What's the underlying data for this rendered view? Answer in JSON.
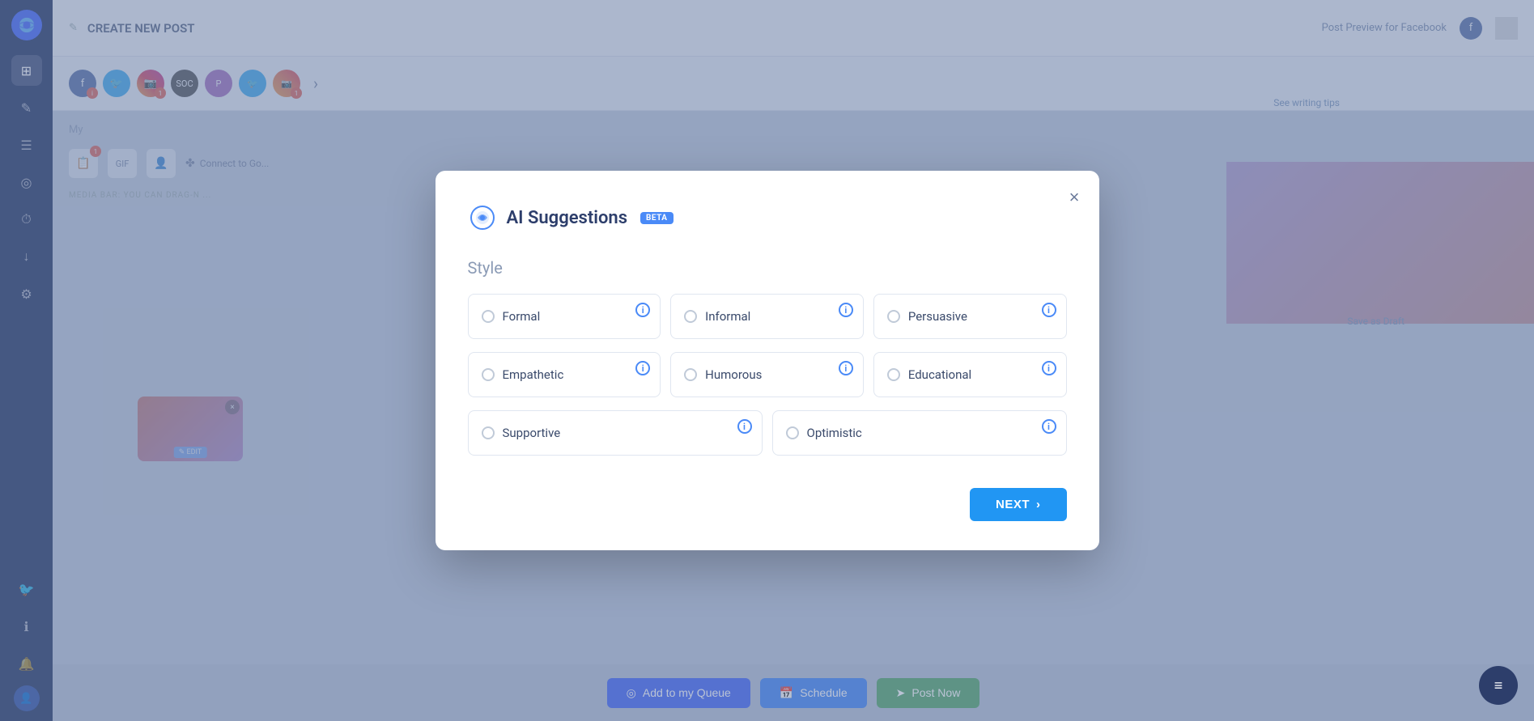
{
  "app": {
    "title": "CREATE NEW POST",
    "beta_label": "BETA"
  },
  "sidebar": {
    "logo_icon": "🌐",
    "items": [
      {
        "label": "dashboard",
        "icon": "⊞",
        "active": false
      },
      {
        "label": "compose",
        "icon": "✎",
        "active": true
      },
      {
        "label": "posts",
        "icon": "☰",
        "active": false
      },
      {
        "label": "feed",
        "icon": "◉",
        "active": false
      },
      {
        "label": "analytics",
        "icon": "⏱",
        "active": false
      },
      {
        "label": "download",
        "icon": "↓",
        "active": false
      },
      {
        "label": "settings",
        "icon": "⚙",
        "active": false
      }
    ],
    "bottom_items": [
      {
        "label": "twitter",
        "icon": "🐦"
      },
      {
        "label": "info",
        "icon": "ℹ"
      },
      {
        "label": "notifications",
        "icon": "🔔"
      },
      {
        "label": "profile",
        "icon": "👤"
      }
    ]
  },
  "topbar": {
    "preview_label": "Post Preview for Facebook",
    "writing_tips_label": "See writing tips"
  },
  "modal": {
    "title": "AI Suggestions",
    "beta_badge": "BETA",
    "section_title": "Style",
    "close_label": "×",
    "style_options": [
      {
        "id": "formal",
        "label": "Formal",
        "selected": false
      },
      {
        "id": "informal",
        "label": "Informal",
        "selected": false
      },
      {
        "id": "persuasive",
        "label": "Persuasive",
        "selected": false
      },
      {
        "id": "empathetic",
        "label": "Empathetic",
        "selected": false
      },
      {
        "id": "humorous",
        "label": "Humorous",
        "selected": false
      },
      {
        "id": "educational",
        "label": "Educational",
        "selected": false
      },
      {
        "id": "supportive",
        "label": "Supportive",
        "selected": false
      },
      {
        "id": "optimistic",
        "label": "Optimistic",
        "selected": false
      }
    ],
    "next_button_label": "NEXT",
    "next_arrow": "›"
  },
  "bottom_bar": {
    "queue_label": "Add to my Queue",
    "schedule_label": "Schedule",
    "post_label": "Post Now"
  },
  "chat_fab_icon": "≡"
}
